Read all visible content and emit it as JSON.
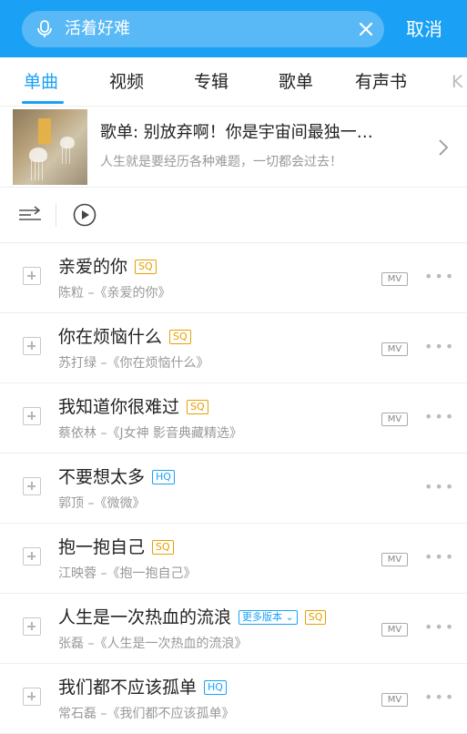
{
  "search": {
    "query": "活着好难",
    "mic_icon": "mic-icon",
    "clear_icon": "close-icon",
    "cancel_label": "取消"
  },
  "tabs": [
    {
      "label": "单曲",
      "active": true
    },
    {
      "label": "视频",
      "active": false
    },
    {
      "label": "专辑",
      "active": false
    },
    {
      "label": "歌单",
      "active": false
    },
    {
      "label": "有声书",
      "active": false
    },
    {
      "label": "K",
      "active": false
    }
  ],
  "playlist_card": {
    "title": "歌单: 别放弃啊！你是宇宙间最独一…",
    "subtitle": "人生就是要经历各种难题，一切都会过去！",
    "chevron_icon": "chevron-right-icon"
  },
  "controls": {
    "shuffle_icon": "shuffle-icon",
    "play_icon": "play-circle-icon"
  },
  "songs": [
    {
      "title": "亲爱的你",
      "badge": "SQ",
      "badge_type": "sq",
      "extra_badge": "",
      "artist_album": "陈粒 –《亲爱的你》",
      "mv": "MV"
    },
    {
      "title": "你在烦恼什么",
      "badge": "SQ",
      "badge_type": "sq",
      "extra_badge": "",
      "artist_album": "苏打绿 –《你在烦恼什么》",
      "mv": "MV"
    },
    {
      "title": "我知道你很难过",
      "badge": "SQ",
      "badge_type": "sq",
      "extra_badge": "",
      "artist_album": "蔡依林 –《J女神 影音典藏精选》",
      "mv": "MV"
    },
    {
      "title": "不要想太多",
      "badge": "HQ",
      "badge_type": "hq",
      "extra_badge": "",
      "artist_album": "郭顶 –《微微》",
      "mv": ""
    },
    {
      "title": "抱一抱自己",
      "badge": "SQ",
      "badge_type": "sq",
      "extra_badge": "",
      "artist_album": "江映蓉 –《抱一抱自己》",
      "mv": "MV"
    },
    {
      "title": "人生是一次热血的流浪",
      "badge": "SQ",
      "badge_type": "sq",
      "extra_badge": "更多版本 ⌄",
      "artist_album": "张磊 –《人生是一次热血的流浪》",
      "mv": "MV"
    },
    {
      "title": "我们都不应该孤单",
      "badge": "HQ",
      "badge_type": "hq",
      "extra_badge": "",
      "artist_album": "常石磊 –《我们都不应该孤单》",
      "mv": "MV"
    }
  ],
  "colors": {
    "accent": "#1aa1f5",
    "sq_badge": "#e6a000",
    "hq_badge": "#1aa1f5"
  }
}
